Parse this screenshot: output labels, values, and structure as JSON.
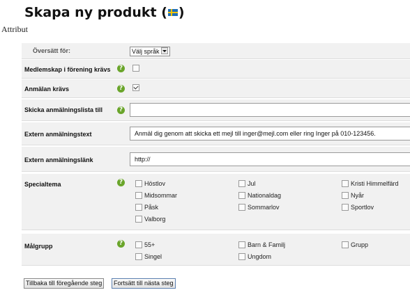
{
  "page": {
    "title_prefix": "Skapa ny produkt (",
    "title_suffix": ")",
    "section": "Attribut"
  },
  "rows": {
    "translate": {
      "label": "Översätt för:",
      "select_value": "Välj språk"
    },
    "membership": {
      "label": "Medlemskap i förening krävs",
      "checked": false
    },
    "registration": {
      "label": "Anmälan krävs",
      "checked": true
    },
    "send_list": {
      "label": "Skicka anmälningslista till",
      "value": ""
    },
    "external_text": {
      "label": "Extern anmälningstext",
      "value": "Anmäl dig genom att skicka ett mejl till inger@mejl.com eller ring Inger på 010-123456."
    },
    "external_link": {
      "label": "Extern anmälningslänk",
      "value": "http://"
    },
    "theme": {
      "label": "Specialtema",
      "options": [
        "Höstlov",
        "Jul",
        "Kristi Himmelfärd",
        "Midsommar",
        "Nationaldag",
        "Nyår",
        "Påsk",
        "Sommarlov",
        "Sportlov",
        "Valborg"
      ]
    },
    "target": {
      "label": "Målgrupp",
      "options": [
        "55+",
        "Barn & Familj",
        "Grupp",
        "Singel",
        "Ungdom"
      ]
    }
  },
  "buttons": {
    "back": "Tillbaka till föregående steg",
    "next": "Fortsätt till nästa steg"
  },
  "icons": {
    "help": "help-icon",
    "flag": "swedish-flag-icon",
    "dropdown": "chevron-down-icon"
  },
  "colors": {
    "help_icon": "#6aa52b",
    "row_bg": "#f1f1f1",
    "flag_blue": "#1f6fb8",
    "flag_yellow": "#f3c300"
  }
}
